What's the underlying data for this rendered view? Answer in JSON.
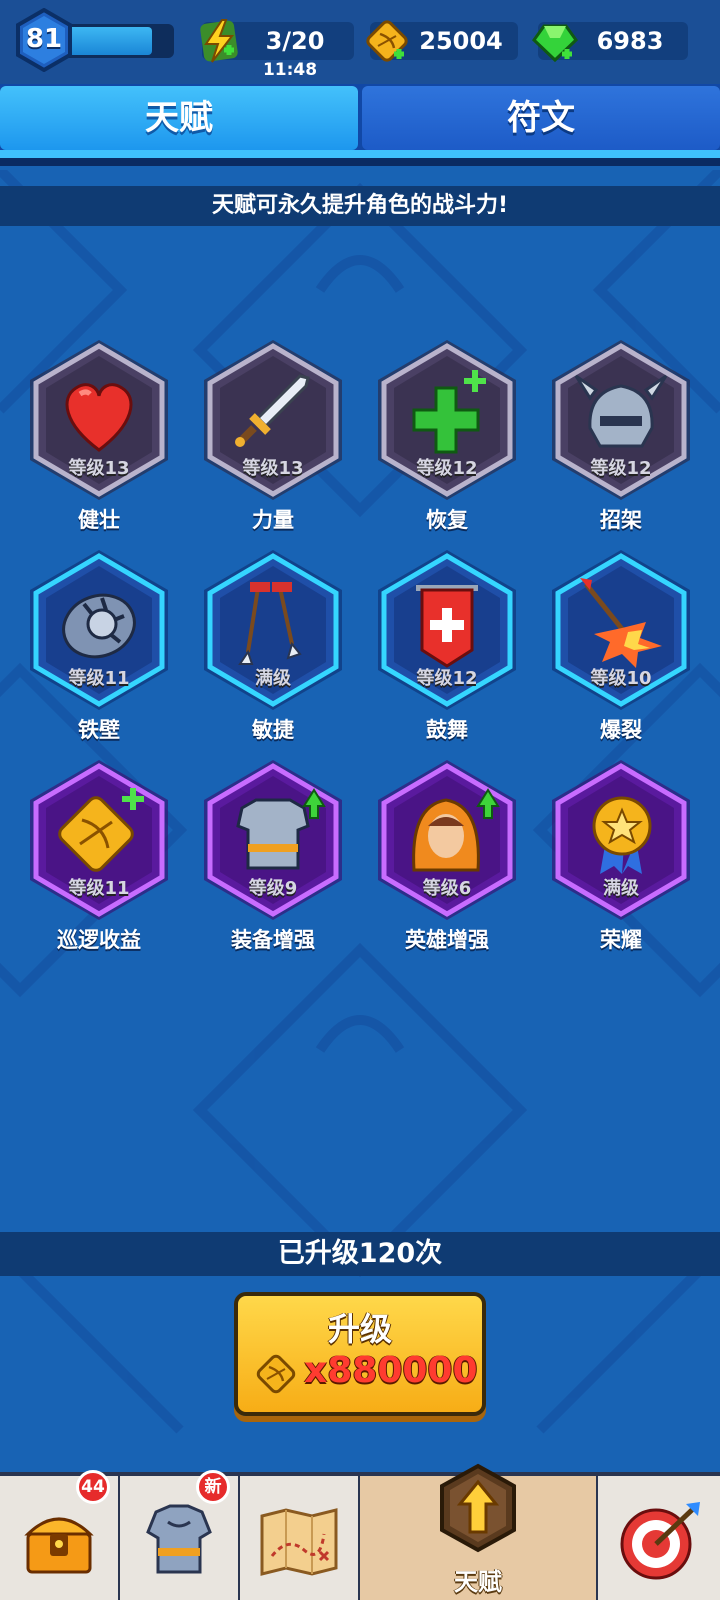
{
  "player": {
    "level": "81",
    "xp_fraction": 0.8
  },
  "resources": {
    "energy": {
      "value": "3/20",
      "timer": "11:48",
      "icon": "lightning-icon"
    },
    "gold": {
      "value": "25004",
      "icon": "bow-coin-icon"
    },
    "gems": {
      "value": "6983",
      "icon": "green-gem-icon"
    }
  },
  "tabs": [
    {
      "label": "天赋",
      "active": true
    },
    {
      "label": "符文",
      "active": false
    }
  ],
  "description": "天赋可永久提升角色的战斗力!",
  "talents": [
    {
      "name": "健壮",
      "level": "等级13",
      "tier": "gray",
      "icon": "heart-icon"
    },
    {
      "name": "力量",
      "level": "等级13",
      "tier": "gray",
      "icon": "sword-icon"
    },
    {
      "name": "恢复",
      "level": "等级12",
      "tier": "gray",
      "icon": "green-plus-icon"
    },
    {
      "name": "招架",
      "level": "等级12",
      "tier": "gray",
      "icon": "helmet-icon"
    },
    {
      "name": "铁壁",
      "level": "等级11",
      "tier": "blue",
      "icon": "spiked-shield-icon"
    },
    {
      "name": "敏捷",
      "level": "满级",
      "tier": "blue",
      "icon": "arrows-icon"
    },
    {
      "name": "鼓舞",
      "level": "等级12",
      "tier": "blue",
      "icon": "banner-icon"
    },
    {
      "name": "爆裂",
      "level": "等级10",
      "tier": "blue",
      "icon": "exploding-arrow-icon"
    },
    {
      "name": "巡逻收益",
      "level": "等级11",
      "tier": "purple",
      "icon": "coin-plus-icon"
    },
    {
      "name": "装备增强",
      "level": "等级9",
      "tier": "purple",
      "icon": "armor-up-icon"
    },
    {
      "name": "英雄增强",
      "level": "等级6",
      "tier": "purple",
      "icon": "hero-up-icon"
    },
    {
      "name": "荣耀",
      "level": "满级",
      "tier": "purple",
      "icon": "medal-icon"
    }
  ],
  "upgrade": {
    "count_text": "已升级120次",
    "button_label": "升级",
    "cost": "x880000"
  },
  "nav": [
    {
      "name": "chest",
      "badge": "44",
      "icon": "treasure-chest-icon"
    },
    {
      "name": "equipment",
      "badge": "新",
      "icon": "armor-icon"
    },
    {
      "name": "map",
      "icon": "treasure-map-icon"
    },
    {
      "name": "talent",
      "label": "天赋",
      "active": true,
      "icon": "up-arrow-icon"
    },
    {
      "name": "target",
      "icon": "target-icon"
    }
  ],
  "colors": {
    "background": "#1863b4",
    "gray_tier": "#4a4064",
    "blue_tier": "#1f4fa8",
    "purple_tier": "#5a1a9e",
    "upgrade_button": "#f7ad16"
  }
}
